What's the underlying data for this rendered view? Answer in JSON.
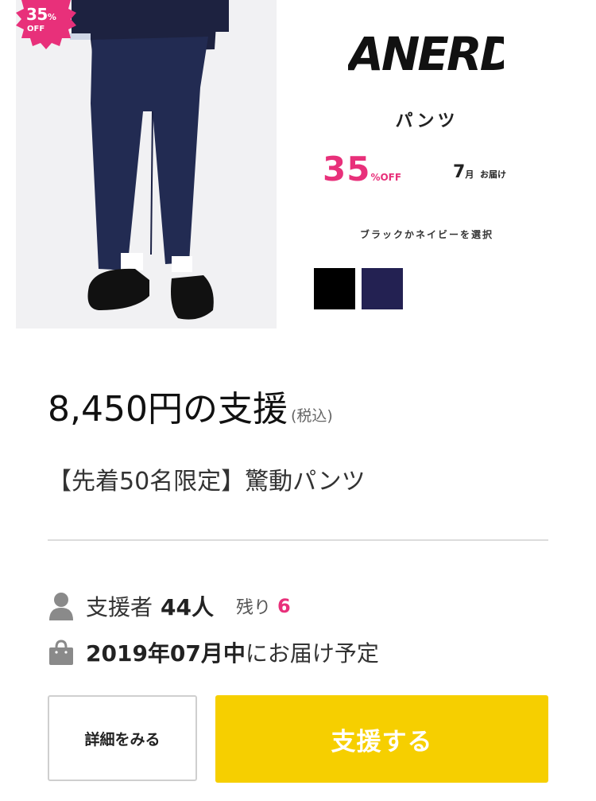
{
  "product": {
    "badge": {
      "percent": "35",
      "percent_sign": "%",
      "off": "OFF"
    },
    "brand": "ANERD",
    "type_label": "パンツ",
    "discount": {
      "value": "35",
      "suffix": "%OFF"
    },
    "delivery_mini": {
      "month": "7",
      "month_unit": "月",
      "text": "お届け"
    },
    "color_prompt": "ブラックかネイビーを選択",
    "swatches": [
      {
        "name": "black",
        "color": "#000000"
      },
      {
        "name": "navy",
        "color": "#232152"
      }
    ]
  },
  "offer": {
    "price": "8,450円の支援",
    "tax_note": "(税込)",
    "title": "【先着50名限定】驚動パンツ"
  },
  "stats": {
    "backers_label": "支援者",
    "backers_count": "44人",
    "remaining_label": "残り",
    "remaining_count": "6",
    "shipping_date": "2019年07月中",
    "shipping_suffix": "にお届け予定"
  },
  "buttons": {
    "detail": "詳細をみる",
    "support": "支援する"
  },
  "colors": {
    "accent_pink": "#e8307a",
    "support_yellow": "#f6cf00",
    "divider": "#dcdcdc",
    "icon_gray": "#8a8a8a"
  },
  "icons": [
    "person-icon",
    "shopping-bag-icon"
  ]
}
